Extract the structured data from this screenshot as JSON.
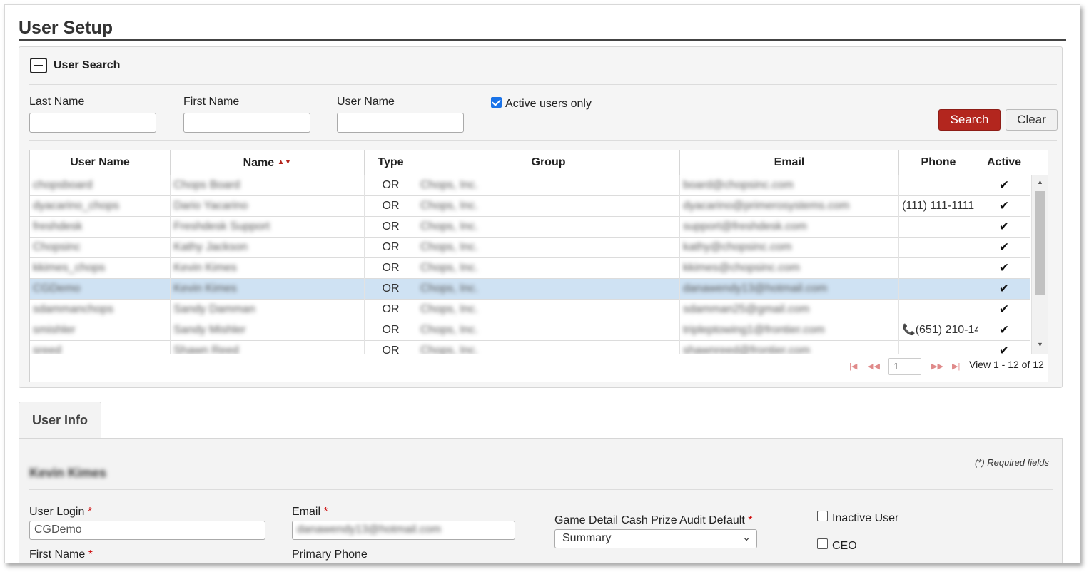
{
  "page": {
    "title": "User Setup"
  },
  "search": {
    "heading": "User Search",
    "last_name_label": "Last Name",
    "first_name_label": "First Name",
    "user_name_label": "User Name",
    "last_name_value": "",
    "first_name_value": "",
    "user_name_value": "",
    "active_only_label": "Active users only",
    "active_only_checked": true,
    "search_button": "Search",
    "clear_button": "Clear"
  },
  "grid": {
    "columns": [
      "User Name",
      "Name",
      "Type",
      "Group",
      "Email",
      "Phone",
      "Active"
    ],
    "sort_indicator": "▲▼",
    "rows": [
      {
        "user_name": "chopsboard",
        "name": "Chops Board",
        "type": "OR",
        "group": "Chops, Inc.",
        "email": "board@chopsinc.com",
        "phone": "",
        "active": "✔"
      },
      {
        "user_name": "dyacarino_chops",
        "name": "Dario Yacarino",
        "type": "OR",
        "group": "Chops, Inc.",
        "email": "dyacarino@primerosystems.com",
        "phone": "(111) 111-1111",
        "active": "✔"
      },
      {
        "user_name": "freshdesk",
        "name": "Freshdesk Support",
        "type": "OR",
        "group": "Chops, Inc.",
        "email": "support@freshdesk.com",
        "phone": "",
        "active": "✔"
      },
      {
        "user_name": "Chopsinc",
        "name": "Kathy Jackson",
        "type": "OR",
        "group": "Chops, Inc.",
        "email": "kathy@chopsinc.com",
        "phone": "",
        "active": "✔"
      },
      {
        "user_name": "kkimes_chops",
        "name": "Kevin Kimes",
        "type": "OR",
        "group": "Chops, Inc.",
        "email": "kkimes@chopsinc.com",
        "phone": "",
        "active": "✔"
      },
      {
        "user_name": "CGDemo",
        "name": "Kevin Kimes",
        "type": "OR",
        "group": "Chops, Inc.",
        "email": "danawendy13@hotmail.com",
        "phone": "",
        "active": "✔",
        "selected": true
      },
      {
        "user_name": "sdammanchops",
        "name": "Sandy Damman",
        "type": "OR",
        "group": "Chops, Inc.",
        "email": "sdamman25@gmail.com",
        "phone": "",
        "active": "✔"
      },
      {
        "user_name": "smishler",
        "name": "Sandy Mishler",
        "type": "OR",
        "group": "Chops, Inc.",
        "email": "tripleptowing1@frontier.com",
        "phone": "(651) 210-14",
        "active": "✔"
      },
      {
        "user_name": "sreed",
        "name": "Shawn Reed",
        "type": "OR",
        "group": "Chops, Inc.",
        "email": "shawnreed@frontier.com",
        "phone": "",
        "active": "✔"
      }
    ],
    "pager": {
      "page_value": "1",
      "view_text": "View 1 - 12 of 12"
    }
  },
  "user_info": {
    "tab_label": "User Info",
    "required_note": "(*) Required fields",
    "user_display_name": "Kevin Kimes",
    "required_mark": "*",
    "user_login_label": "User Login",
    "user_login_value": "CGDemo",
    "email_label": "Email",
    "email_value": "danawendy13@hotmail.com",
    "game_detail_label": "Game Detail Cash Prize Audit Default",
    "game_detail_value": "Summary",
    "inactive_user_label": "Inactive User",
    "ceo_label": "CEO",
    "first_name_label": "First Name",
    "primary_phone_label": "Primary Phone"
  },
  "colors": {
    "search_button": "#b3261e",
    "selected_row": "#cfe2f3",
    "checkbox_on": "#1a73e8",
    "required": "#cc0000"
  }
}
